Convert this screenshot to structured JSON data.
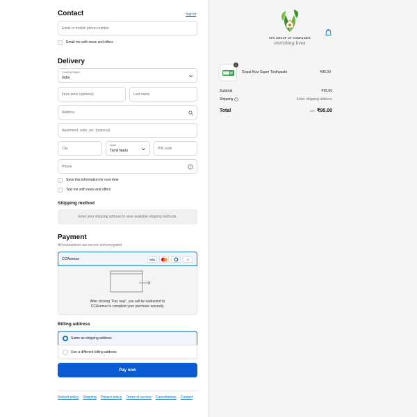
{
  "contact": {
    "heading": "Contact",
    "sign_in": "Sign in",
    "email_placeholder": "Email or mobile phone number",
    "news_label": "Email me with news and offers"
  },
  "delivery": {
    "heading": "Delivery",
    "country_label": "Country/Region",
    "country_value": "India",
    "first_name": "First name (optional)",
    "last_name": "Last name",
    "address": "Address",
    "apartment": "Apartment, suite, etc. (optional)",
    "city": "City",
    "state_label": "State",
    "state_value": "Tamil Nadu",
    "pin": "PIN code",
    "phone": "Phone",
    "save_info": "Save this information for next time",
    "text_me": "Text me with news and offers"
  },
  "shipping": {
    "heading": "Shipping method",
    "notice": "Enter your shipping address to view available shipping methods."
  },
  "payment": {
    "heading": "Payment",
    "subtitle": "All transactions are secure and encrypted.",
    "method": "CCAvenue",
    "cards": [
      "VISA",
      "MC",
      "DC",
      "+3"
    ],
    "redirect_line1": "After clicking “Pay now”, you will be redirected to",
    "redirect_line2": "CCAvenue to complete your purchase securely."
  },
  "billing": {
    "heading": "Billing address",
    "same": "Same as shipping address",
    "different": "Use a different billing address"
  },
  "pay_now": "Pay now",
  "footer_links": [
    "Refund policy",
    "Shipping",
    "Privacy policy",
    "Terms of service",
    "Cancellations",
    "Contact"
  ],
  "brand": {
    "company": "SPS GROUP OF COMPANIES",
    "tagline": "enriching lives"
  },
  "order": {
    "item_name": "Gopal Novi Super Toothpaste",
    "item_qty": "1",
    "item_price": "₹95.00",
    "subtotal_label": "Subtotal",
    "subtotal_value": "₹95.00",
    "shipping_label": "Shipping",
    "shipping_value": "Enter shipping address",
    "total_label": "Total",
    "currency": "INR",
    "total_value": "₹95.00"
  },
  "colors": {
    "accent": "#1773b0",
    "button": "#0b5bd3",
    "brand_green": "#3f8f2f"
  }
}
